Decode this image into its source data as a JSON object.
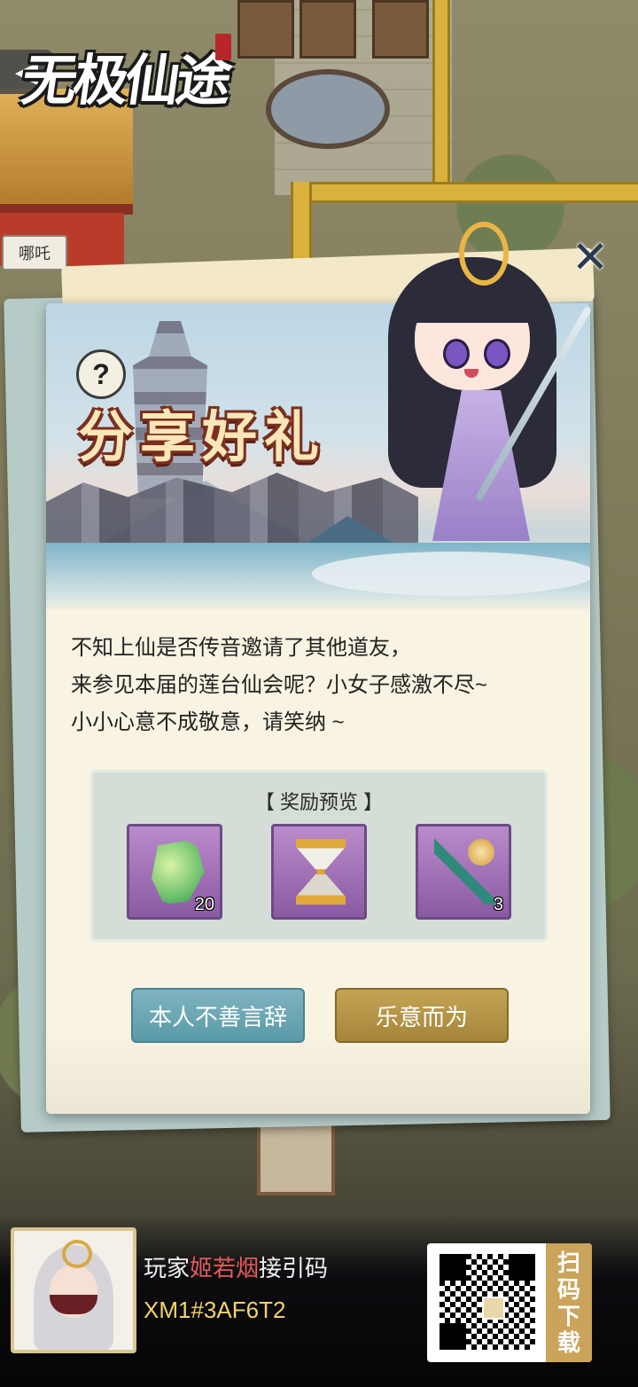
{
  "app": {
    "logo_text": "无极仙途",
    "back_icon": "back-arrow-icon"
  },
  "background": {
    "npc_name": "哪吒"
  },
  "dialog": {
    "title": "分享好礼",
    "help_label": "?",
    "close_label": "✕",
    "description": [
      "不知上仙是否传音邀请了其他道友，",
      "来参见本届的莲台仙会呢？小女子感激不尽~",
      "小小心意不成敬意，请笑纳 ~"
    ],
    "reward_title": "【 奖励预览 】",
    "rewards": [
      {
        "icon": "jade-pendant-icon",
        "count": "20"
      },
      {
        "icon": "golden-hourglass-icon",
        "count": ""
      },
      {
        "icon": "magic-staff-icon",
        "count": "3"
      }
    ],
    "decline_label": "本人不善言辞",
    "accept_label": "乐意而为"
  },
  "footer": {
    "invite_prefix": "玩家",
    "player_name": "姬若烟",
    "invite_suffix": "接引码",
    "invite_code": "XM1#3AF6T2",
    "qr_label": [
      "扫",
      "码",
      "下",
      "载"
    ]
  },
  "colors": {
    "title_fill": "#fbe6b8",
    "decline_button": "#6aa8b6",
    "accept_button": "#b89a48",
    "player_name": "#e25a5a",
    "invite_code": "#f2d36a"
  }
}
